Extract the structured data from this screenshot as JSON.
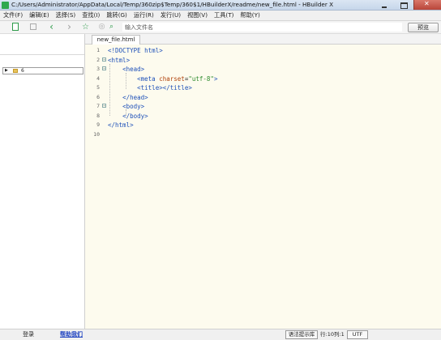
{
  "window": {
    "title": "C:/Users/Administrator/AppData/Local/Temp/360zip$Temp/360$1/HBuilderX/readme/new_file.html - HBuilder X"
  },
  "menu": [
    "文件(F)",
    "编辑(E)",
    "选择(S)",
    "查找(I)",
    "跳转(G)",
    "运行(R)",
    "发行(U)",
    "视图(V)",
    "工具(T)",
    "帮助(Y)"
  ],
  "toolbar": {
    "icons": [
      "new-file-icon",
      "save-icon",
      "back-arrow-icon",
      "forward-arrow-icon",
      "favorite-star-icon",
      "circle-icon",
      "find-icon"
    ],
    "search_placeholder": "输入文件名",
    "preview_label": "预览"
  },
  "sidebar": {
    "tree_item": "6"
  },
  "tabs": [
    {
      "label": "new_file.html",
      "active": true
    }
  ],
  "editor": {
    "lines": [
      {
        "num": "1",
        "fold": "",
        "tokens": [
          [
            "c-tag",
            "<!DOCTYPE html>"
          ]
        ]
      },
      {
        "num": "2",
        "fold": "⊟",
        "tokens": [
          [
            "c-tag",
            "<html>"
          ]
        ]
      },
      {
        "num": "3",
        "fold": "⊟",
        "tokens": [
          [
            "c-plain",
            "    "
          ],
          [
            "c-tag",
            "<head>"
          ]
        ]
      },
      {
        "num": "4",
        "fold": "",
        "tokens": [
          [
            "c-plain",
            "        "
          ],
          [
            "c-tag",
            "<meta "
          ],
          [
            "c-attr",
            "charset"
          ],
          [
            "c-plain",
            "="
          ],
          [
            "c-val",
            "\"utf-8\""
          ],
          [
            "c-tag",
            ">"
          ]
        ]
      },
      {
        "num": "5",
        "fold": "",
        "tokens": [
          [
            "c-plain",
            "        "
          ],
          [
            "c-tag",
            "<title></title>"
          ]
        ]
      },
      {
        "num": "6",
        "fold": "",
        "tokens": [
          [
            "c-plain",
            "    "
          ],
          [
            "c-tag",
            "</head>"
          ]
        ]
      },
      {
        "num": "7",
        "fold": "⊟",
        "tokens": [
          [
            "c-plain",
            "    "
          ],
          [
            "c-tag",
            "<body>"
          ]
        ]
      },
      {
        "num": "8",
        "fold": "",
        "tokens": [
          [
            "c-plain",
            "    "
          ],
          [
            "c-tag",
            "</body>"
          ]
        ]
      },
      {
        "num": "9",
        "fold": "",
        "tokens": [
          [
            "c-tag",
            "</html>"
          ]
        ]
      },
      {
        "num": "10",
        "fold": "",
        "tokens": []
      }
    ]
  },
  "status": {
    "login": "登录",
    "help": "帮助我们",
    "syntax_button": "语法提示库",
    "cursor_position": "行:10列:1",
    "encoding": "UTF"
  },
  "colors": {
    "editor_bg": "#fdfbee",
    "tag": "#1c4fb8",
    "attr": "#b0400a",
    "value": "#2c8a2c",
    "accent_green": "#2e9b4a"
  }
}
